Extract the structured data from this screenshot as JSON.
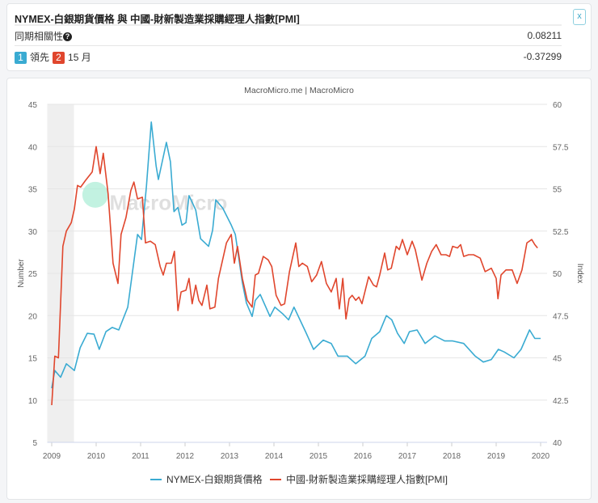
{
  "header": {
    "title": "NYMEX-白銀期貨價格 與 中國-財新製造業採購經理人指數[PMI]",
    "close_label": "x"
  },
  "stats": {
    "concurrent_label": "同期相關性",
    "concurrent_value": "0.08211",
    "badge1": "1",
    "lead_label": "領先",
    "badge2": "2",
    "lead_months": "15 月",
    "lead_value": "-0.37299"
  },
  "colors": {
    "silver": "#3aabd2",
    "pmi": "#e0462d",
    "badge1": "#3aabd2",
    "badge2": "#e0462d"
  },
  "chart_data": {
    "type": "line",
    "title": "MacroMicro.me | MacroMicro",
    "watermark": "MacroMicro",
    "xlabel": "",
    "ylabel": "Number",
    "y2label": "Index",
    "xlim": [
      2008.9,
      2020.15
    ],
    "ylim": [
      5,
      45
    ],
    "y2lim": [
      40,
      60
    ],
    "xticks": [
      "2009",
      "2010",
      "2011",
      "2012",
      "2013",
      "2014",
      "2015",
      "2016",
      "2017",
      "2018",
      "2019",
      "2020"
    ],
    "yticks": [
      "5",
      "10",
      "15",
      "20",
      "25",
      "30",
      "35",
      "40",
      "45"
    ],
    "y2ticks": [
      "40",
      "42.5",
      "45",
      "47.5",
      "50",
      "52.5",
      "55",
      "57.5",
      "60"
    ],
    "shaded_range": [
      2008.9,
      2009.5
    ],
    "legend": "bottom",
    "grid": true,
    "series": [
      {
        "name": "NYMEX-白銀期貨價格",
        "axis": "left",
        "points": [
          [
            2009.0,
            11.4
          ],
          [
            2009.07,
            13.5
          ],
          [
            2009.2,
            12.7
          ],
          [
            2009.33,
            14.3
          ],
          [
            2009.51,
            13.5
          ],
          [
            2009.64,
            16.2
          ],
          [
            2009.8,
            17.9
          ],
          [
            2009.95,
            17.8
          ],
          [
            2010.07,
            16.0
          ],
          [
            2010.22,
            18.1
          ],
          [
            2010.36,
            18.6
          ],
          [
            2010.51,
            18.3
          ],
          [
            2010.71,
            21
          ],
          [
            2010.93,
            29.6
          ],
          [
            2011.02,
            29
          ],
          [
            2011.13,
            35.3
          ],
          [
            2011.24,
            42.9
          ],
          [
            2011.35,
            37.7
          ],
          [
            2011.4,
            36.1
          ],
          [
            2011.58,
            40.5
          ],
          [
            2011.67,
            38.2
          ],
          [
            2011.75,
            32.3
          ],
          [
            2011.84,
            32.8
          ],
          [
            2011.93,
            30.7
          ],
          [
            2012.02,
            31
          ],
          [
            2012.09,
            34.2
          ],
          [
            2012.24,
            32.5
          ],
          [
            2012.35,
            29.1
          ],
          [
            2012.53,
            28.2
          ],
          [
            2012.62,
            30.1
          ],
          [
            2012.69,
            33.7
          ],
          [
            2012.85,
            32.7
          ],
          [
            2013.04,
            30.7
          ],
          [
            2013.13,
            29.6
          ],
          [
            2013.29,
            23.9
          ],
          [
            2013.38,
            21.5
          ],
          [
            2013.51,
            19.9
          ],
          [
            2013.58,
            21.8
          ],
          [
            2013.69,
            22.5
          ],
          [
            2013.91,
            19.9
          ],
          [
            2014.02,
            21
          ],
          [
            2014.2,
            20.2
          ],
          [
            2014.33,
            19.5
          ],
          [
            2014.45,
            21
          ],
          [
            2014.71,
            18.1
          ],
          [
            2014.89,
            16
          ],
          [
            2015.11,
            17.1
          ],
          [
            2015.29,
            16.7
          ],
          [
            2015.44,
            15.2
          ],
          [
            2015.65,
            15.2
          ],
          [
            2015.84,
            14.3
          ],
          [
            2016.05,
            15.2
          ],
          [
            2016.2,
            17.3
          ],
          [
            2016.38,
            18.1
          ],
          [
            2016.53,
            20
          ],
          [
            2016.65,
            19.5
          ],
          [
            2016.78,
            17.9
          ],
          [
            2016.93,
            16.7
          ],
          [
            2017.05,
            18.1
          ],
          [
            2017.22,
            18.3
          ],
          [
            2017.4,
            16.7
          ],
          [
            2017.62,
            17.6
          ],
          [
            2017.84,
            17
          ],
          [
            2018.02,
            17
          ],
          [
            2018.27,
            16.7
          ],
          [
            2018.53,
            15.2
          ],
          [
            2018.71,
            14.5
          ],
          [
            2018.89,
            14.8
          ],
          [
            2019.05,
            16
          ],
          [
            2019.18,
            15.7
          ],
          [
            2019.4,
            15
          ],
          [
            2019.56,
            16
          ],
          [
            2019.75,
            18.3
          ],
          [
            2019.87,
            17.3
          ],
          [
            2020.0,
            17.3
          ]
        ]
      },
      {
        "name": "中國-財新製造業採購經理人指數[PMI]",
        "axis": "right",
        "points": [
          [
            2009.0,
            42.2
          ],
          [
            2009.07,
            45.1
          ],
          [
            2009.15,
            45
          ],
          [
            2009.25,
            51.6
          ],
          [
            2009.33,
            52.5
          ],
          [
            2009.44,
            53
          ],
          [
            2009.51,
            53.8
          ],
          [
            2009.58,
            55.2
          ],
          [
            2009.65,
            55.1
          ],
          [
            2009.76,
            55.5
          ],
          [
            2009.91,
            56
          ],
          [
            2010.0,
            57.5
          ],
          [
            2010.09,
            55.9
          ],
          [
            2010.16,
            57.1
          ],
          [
            2010.27,
            54.7
          ],
          [
            2010.38,
            50.6
          ],
          [
            2010.49,
            49.4
          ],
          [
            2010.56,
            52.3
          ],
          [
            2010.67,
            53.3
          ],
          [
            2010.78,
            54.9
          ],
          [
            2010.85,
            55.4
          ],
          [
            2010.93,
            54.4
          ],
          [
            2011.04,
            54.5
          ],
          [
            2011.11,
            51.8
          ],
          [
            2011.22,
            51.9
          ],
          [
            2011.33,
            51.7
          ],
          [
            2011.44,
            50.4
          ],
          [
            2011.51,
            49.9
          ],
          [
            2011.58,
            50.6
          ],
          [
            2011.69,
            50.6
          ],
          [
            2011.76,
            51.3
          ],
          [
            2011.84,
            47.8
          ],
          [
            2011.91,
            48.9
          ],
          [
            2012.02,
            49
          ],
          [
            2012.09,
            49.7
          ],
          [
            2012.16,
            48.2
          ],
          [
            2012.24,
            49.3
          ],
          [
            2012.31,
            48.4
          ],
          [
            2012.38,
            48.1
          ],
          [
            2012.49,
            49.3
          ],
          [
            2012.56,
            47.9
          ],
          [
            2012.67,
            48
          ],
          [
            2012.75,
            49.7
          ],
          [
            2012.93,
            51.8
          ],
          [
            2013.04,
            52.3
          ],
          [
            2013.11,
            50.6
          ],
          [
            2013.18,
            51.6
          ],
          [
            2013.29,
            49.7
          ],
          [
            2013.4,
            48.4
          ],
          [
            2013.51,
            48
          ],
          [
            2013.58,
            49.9
          ],
          [
            2013.65,
            50
          ],
          [
            2013.76,
            51
          ],
          [
            2013.87,
            50.8
          ],
          [
            2013.95,
            50.4
          ],
          [
            2014.05,
            48.7
          ],
          [
            2014.16,
            48.1
          ],
          [
            2014.24,
            48.2
          ],
          [
            2014.35,
            50.1
          ],
          [
            2014.49,
            51.8
          ],
          [
            2014.56,
            50.4
          ],
          [
            2014.64,
            50.6
          ],
          [
            2014.75,
            50.4
          ],
          [
            2014.85,
            49.5
          ],
          [
            2014.96,
            49.9
          ],
          [
            2015.07,
            50.7
          ],
          [
            2015.18,
            49.4
          ],
          [
            2015.29,
            48.9
          ],
          [
            2015.4,
            49.7
          ],
          [
            2015.47,
            47.9
          ],
          [
            2015.55,
            49.7
          ],
          [
            2015.62,
            47.3
          ],
          [
            2015.69,
            48.5
          ],
          [
            2015.76,
            48.7
          ],
          [
            2015.84,
            48.4
          ],
          [
            2015.91,
            48.6
          ],
          [
            2015.98,
            48.2
          ],
          [
            2016.13,
            49.8
          ],
          [
            2016.24,
            49.3
          ],
          [
            2016.31,
            49.2
          ],
          [
            2016.38,
            49.9
          ],
          [
            2016.49,
            51.2
          ],
          [
            2016.56,
            50.2
          ],
          [
            2016.64,
            50.3
          ],
          [
            2016.75,
            51.6
          ],
          [
            2016.82,
            51.4
          ],
          [
            2016.89,
            52
          ],
          [
            2017.0,
            51.1
          ],
          [
            2017.11,
            51.9
          ],
          [
            2017.18,
            51.4
          ],
          [
            2017.33,
            49.6
          ],
          [
            2017.44,
            50.6
          ],
          [
            2017.55,
            51.3
          ],
          [
            2017.65,
            51.7
          ],
          [
            2017.76,
            51.1
          ],
          [
            2017.87,
            51.1
          ],
          [
            2017.95,
            51
          ],
          [
            2018.02,
            51.6
          ],
          [
            2018.13,
            51.5
          ],
          [
            2018.2,
            51.7
          ],
          [
            2018.27,
            51
          ],
          [
            2018.38,
            51.1
          ],
          [
            2018.49,
            51.1
          ],
          [
            2018.64,
            50.9
          ],
          [
            2018.75,
            50.1
          ],
          [
            2018.89,
            50.3
          ],
          [
            2019.0,
            49.7
          ],
          [
            2019.04,
            48.5
          ],
          [
            2019.11,
            49.9
          ],
          [
            2019.22,
            50.2
          ],
          [
            2019.36,
            50.2
          ],
          [
            2019.47,
            49.4
          ],
          [
            2019.58,
            50.2
          ],
          [
            2019.69,
            51.8
          ],
          [
            2019.8,
            52
          ],
          [
            2019.87,
            51.7
          ],
          [
            2019.93,
            51.5
          ]
        ]
      }
    ]
  }
}
